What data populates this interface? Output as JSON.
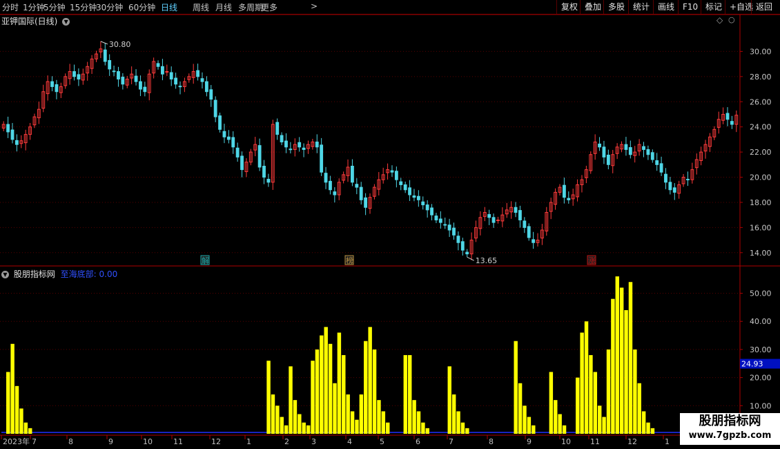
{
  "toolbar": {
    "periods": [
      {
        "label": "分时",
        "active": false
      },
      {
        "label": "1分钟",
        "active": false
      },
      {
        "label": "5分钟",
        "active": false
      },
      {
        "label": "15分钟",
        "active": false
      },
      {
        "label": "30分钟",
        "active": false
      },
      {
        "label": "60分钟",
        "active": false
      },
      {
        "label": "日线",
        "active": true
      },
      {
        "label": "周线",
        "active": false
      },
      {
        "label": "月线",
        "active": false
      },
      {
        "label": "多周期",
        "active": false
      },
      {
        "label": "更多",
        "active": false
      }
    ],
    "more_arrow": ">",
    "actions": [
      "复权",
      "叠加",
      "多股",
      "统计",
      "画线",
      "F10",
      "标记",
      "+自选",
      "返回"
    ]
  },
  "price_pane": {
    "title": "亚钾国际(日线)",
    "high_label": "30.80",
    "low_label": "13.65",
    "y_ticks": [
      "30.00",
      "28.00",
      "26.00",
      "24.00",
      "22.00",
      "20.00",
      "18.00",
      "16.00",
      "14.00"
    ],
    "markers": [
      {
        "text": "解",
        "color": "#1aa7a7"
      },
      {
        "text": "榜",
        "color": "#b89040"
      },
      {
        "text": "涨",
        "color": "#c01010"
      }
    ]
  },
  "indicator_pane": {
    "title": "股朋指标网",
    "series_label": "至海底部: 0.00",
    "y_ticks": [
      "50.00",
      "40.00",
      "30.00",
      "20.00",
      "10.00"
    ],
    "current_value": "24.93"
  },
  "x_axis": {
    "labels": [
      "2023年",
      "7",
      "8",
      "9",
      "10",
      "11",
      "12",
      "1",
      "2",
      "3",
      "4",
      "5",
      "6",
      "7",
      "8",
      "9",
      "10",
      "11",
      "12",
      "1"
    ]
  },
  "watermark": {
    "line1": "股朋指标网",
    "line2": "www.7gpzb.com"
  },
  "colors": {
    "up": "#ff3b3b",
    "down": "#4fd6e6",
    "bar": "#ffff00",
    "baseline": "#2030ff",
    "axis": "#b00000",
    "grid": "#5a0000"
  },
  "chart_data": {
    "type": "candlestick",
    "price": {
      "ylim": [
        13.0,
        32.0
      ],
      "high": 30.8,
      "low": 13.65,
      "current": 24.93,
      "closes": [
        24.2,
        23.6,
        23.0,
        22.6,
        22.9,
        23.4,
        24.0,
        24.8,
        25.4,
        26.8,
        27.6,
        27.2,
        26.8,
        27.2,
        28.0,
        28.4,
        28.0,
        27.8,
        28.2,
        28.8,
        29.4,
        29.8,
        30.2,
        29.2,
        28.6,
        28.4,
        27.8,
        27.4,
        27.8,
        28.2,
        27.6,
        27.0,
        26.8,
        28.2,
        29.2,
        28.8,
        28.2,
        28.4,
        27.8,
        27.4,
        27.2,
        27.6,
        28.0,
        28.4,
        28.0,
        27.6,
        26.8,
        26.2,
        24.8,
        23.8,
        23.2,
        23.0,
        22.4,
        21.6,
        20.6,
        21.2,
        22.0,
        22.6,
        20.8,
        20.0,
        19.6,
        24.2,
        23.4,
        22.8,
        22.4,
        22.2,
        22.6,
        22.4,
        22.2,
        22.6,
        22.8,
        22.4,
        20.4,
        19.6,
        19.0,
        18.6,
        19.6,
        20.2,
        20.8,
        19.6,
        19.2,
        18.2,
        17.6,
        18.4,
        19.2,
        19.8,
        20.2,
        20.6,
        20.4,
        19.8,
        19.4,
        19.0,
        18.6,
        18.4,
        18.2,
        17.8,
        17.4,
        17.0,
        16.6,
        16.4,
        16.2,
        15.8,
        15.4,
        14.8,
        14.2,
        13.9,
        15.0,
        16.0,
        16.8,
        17.2,
        16.8,
        16.4,
        16.6,
        17.0,
        17.4,
        17.6,
        17.2,
        16.6,
        16.0,
        15.2,
        14.8,
        15.0,
        15.8,
        17.2,
        18.0,
        18.8,
        19.2,
        18.4,
        18.2,
        18.6,
        19.4,
        19.8,
        20.6,
        21.8,
        22.8,
        22.4,
        21.6,
        21.0,
        21.8,
        22.4,
        22.6,
        22.2,
        21.8,
        22.0,
        22.6,
        22.2,
        21.8,
        21.4,
        21.0,
        20.4,
        19.6,
        19.0,
        18.8,
        19.4,
        20.0,
        19.8,
        20.6,
        21.4,
        22.0,
        22.6,
        23.2,
        23.8,
        24.6,
        25.0,
        24.6,
        24.2,
        24.93
      ]
    },
    "indicator": {
      "name": "至海底部",
      "current": 0.0,
      "ylim": [
        0,
        58
      ],
      "bars": [
        [
          1,
          22
        ],
        [
          2,
          32
        ],
        [
          3,
          17
        ],
        [
          4,
          9
        ],
        [
          5,
          4
        ],
        [
          6,
          2
        ],
        [
          60,
          26
        ],
        [
          61,
          14
        ],
        [
          62,
          10
        ],
        [
          63,
          6
        ],
        [
          64,
          3
        ],
        [
          65,
          24
        ],
        [
          66,
          12
        ],
        [
          67,
          7
        ],
        [
          68,
          4
        ],
        [
          69,
          3
        ],
        [
          70,
          26
        ],
        [
          71,
          30
        ],
        [
          72,
          35
        ],
        [
          73,
          38
        ],
        [
          74,
          32
        ],
        [
          75,
          18
        ],
        [
          76,
          36
        ],
        [
          77,
          28
        ],
        [
          78,
          14
        ],
        [
          79,
          8
        ],
        [
          80,
          5
        ],
        [
          81,
          14
        ],
        [
          82,
          33
        ],
        [
          83,
          38
        ],
        [
          84,
          30
        ],
        [
          85,
          12
        ],
        [
          86,
          8
        ],
        [
          87,
          4
        ],
        [
          91,
          28
        ],
        [
          92,
          28
        ],
        [
          93,
          12
        ],
        [
          94,
          8
        ],
        [
          95,
          4
        ],
        [
          96,
          2
        ],
        [
          101,
          24
        ],
        [
          102,
          14
        ],
        [
          103,
          8
        ],
        [
          104,
          4
        ],
        [
          105,
          2
        ],
        [
          116,
          33
        ],
        [
          117,
          18
        ],
        [
          118,
          10
        ],
        [
          119,
          6
        ],
        [
          120,
          3
        ],
        [
          124,
          22
        ],
        [
          125,
          12
        ],
        [
          126,
          7
        ],
        [
          127,
          3
        ],
        [
          130,
          20
        ],
        [
          131,
          36
        ],
        [
          132,
          40
        ],
        [
          133,
          28
        ],
        [
          134,
          22
        ],
        [
          135,
          10
        ],
        [
          136,
          6
        ],
        [
          137,
          30
        ],
        [
          138,
          48
        ],
        [
          139,
          56
        ],
        [
          140,
          52
        ],
        [
          141,
          44
        ],
        [
          142,
          54
        ],
        [
          143,
          30
        ],
        [
          144,
          18
        ],
        [
          145,
          8
        ],
        [
          146,
          4
        ],
        [
          147,
          2
        ]
      ],
      "baseline": 0.5
    }
  }
}
